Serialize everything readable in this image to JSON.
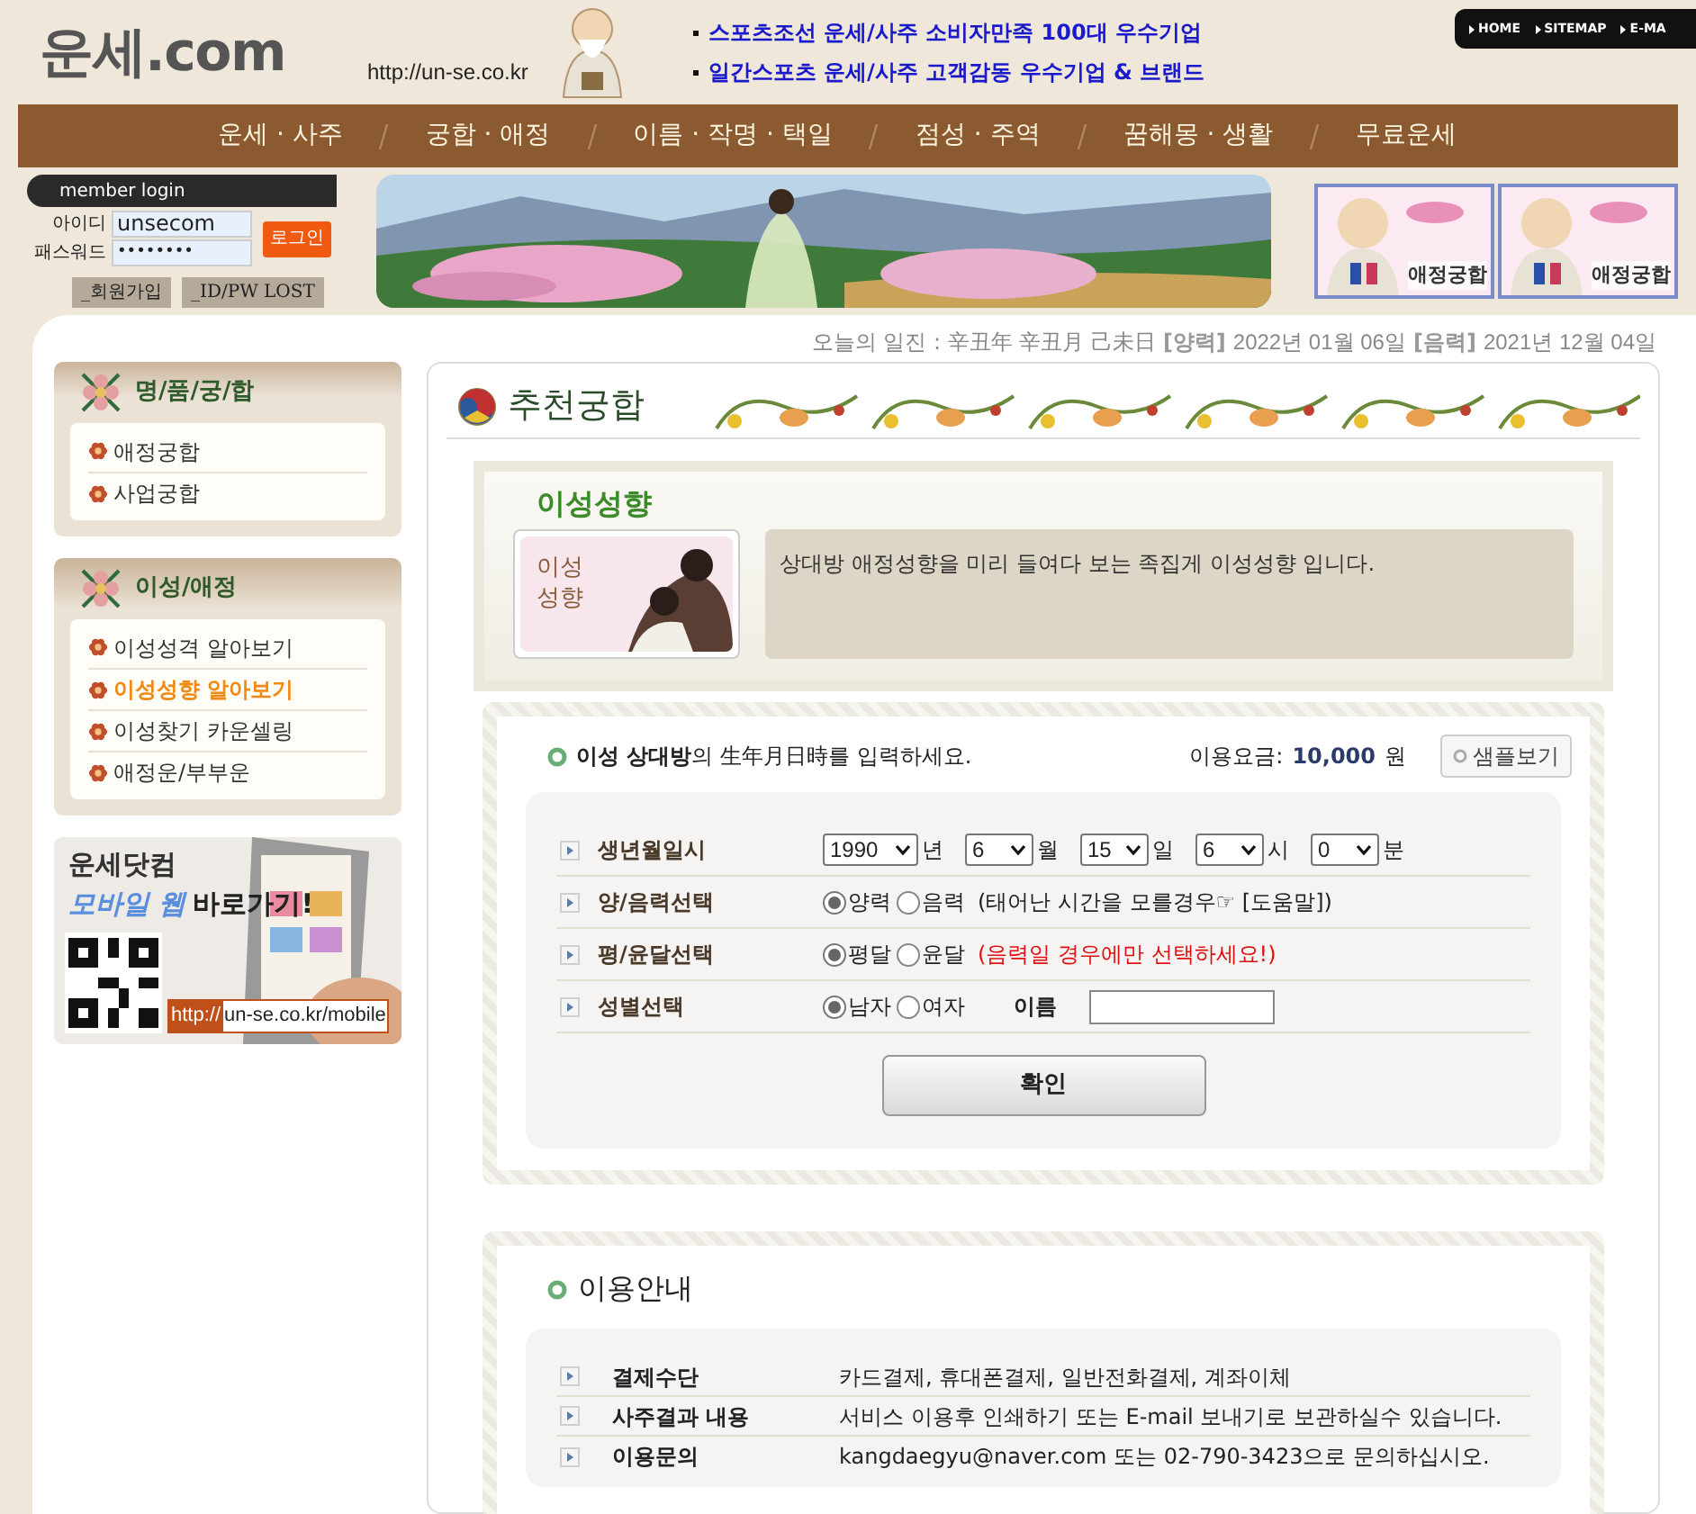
{
  "header": {
    "logo": "운세.com",
    "url": "http://un-se.co.kr",
    "headlines": [
      "스포츠조선 운세/사주 소비자만족 100대 우수기업",
      "일간스포츠 운세/사주 고객감동 우수기업 & 브랜드"
    ],
    "top_links": [
      "HOME",
      "SITEMAP",
      "E-MA"
    ]
  },
  "nav": [
    "운세 · 사주",
    "궁합 · 애정",
    "이름 · 작명 · 택일",
    "점성 · 주역",
    "꿈해몽 · 생활",
    "무료운세"
  ],
  "login": {
    "title": "member login",
    "id_label": "아이디",
    "id_value": "unsecom",
    "pw_label": "패스워드",
    "pw_value": "••••••••",
    "login_button": "로그인",
    "buttons": [
      "_회원가입",
      "_ID/PW LOST"
    ]
  },
  "banner_badges": [
    "애정궁합",
    "애정궁합"
  ],
  "date_line": {
    "label": "오늘의 일진 : 辛丑年 辛丑月 己未日",
    "solar_label": "[양력]",
    "solar": "2022년 01월 06일",
    "lunar_label": "[음력]",
    "lunar": "2021년 12월 04일"
  },
  "sidebar": [
    {
      "title": "명/품/궁/합",
      "items": [
        {
          "label": "애정궁합",
          "selected": false
        },
        {
          "label": "사업궁합",
          "selected": false
        }
      ]
    },
    {
      "title": "이성/애정",
      "items": [
        {
          "label": "이성성격 알아보기",
          "selected": false
        },
        {
          "label": "이성성향 알아보기",
          "selected": true
        },
        {
          "label": "이성찾기 카운셀링",
          "selected": false
        },
        {
          "label": "애정운/부부운",
          "selected": false
        }
      ]
    }
  ],
  "mobile_banner": {
    "brand": "운세닷컴",
    "line_1": "모바일 웹",
    "line_2": "바로가기!",
    "url_prefix": "http://",
    "url": "un-se.co.kr/mobile"
  },
  "main": {
    "title": "추천궁합",
    "section_title": "이성성향",
    "thumb_lines": [
      "이성",
      "성향"
    ],
    "description": "상대방 애정성향을 미리 들여다 보는 족집게 이성성향 입니다."
  },
  "form": {
    "intro": "**이성 상대방**의 生年月日時를 입력하세요.",
    "fee_label": "이용요금:",
    "fee": "10,000",
    "fee_unit": "원",
    "sample_button": "샘플보기",
    "rows": [
      {
        "kind": "date",
        "label": "생년월일시",
        "selects": [
          {
            "value": "1990",
            "unit": "년"
          },
          {
            "value": "6",
            "unit": "월"
          },
          {
            "value": "15",
            "unit": "일"
          },
          {
            "value": "6",
            "unit": "시"
          },
          {
            "value": "0",
            "unit": "분"
          }
        ]
      },
      {
        "kind": "radio",
        "label": "양/음력선택",
        "options": [
          {
            "label": "양력",
            "selected": true
          },
          {
            "label": "음력",
            "selected": false
          }
        ],
        "note": "(태어난 시간을 모를경우☞ [도움말])",
        "alert": false
      },
      {
        "kind": "radio",
        "label": "평/윤달선택",
        "options": [
          {
            "label": "평달",
            "selected": true
          },
          {
            "label": "윤달",
            "selected": false
          }
        ],
        "note": "(음력일 경우에만 선택하세요!)",
        "alert": true
      },
      {
        "kind": "gender",
        "label": "성별선택",
        "options": [
          {
            "label": "남자",
            "selected": true
          },
          {
            "label": "여자",
            "selected": false
          }
        ],
        "name_label": "이름"
      }
    ],
    "submit": "확인"
  },
  "info": {
    "title": "이용안내",
    "rows": [
      {
        "label": "결제수단",
        "value": "카드결제, 휴대폰결제, 일반전화결제, 계좌이체"
      },
      {
        "label": "사주결과 내용",
        "value": "서비스 이용후 인쇄하기 또는 E-mail 보내기로 보관하실수 있습니다."
      },
      {
        "label": "이용문의",
        "value": "kangdaegyu@naver.com 또는 02-790-3423으로 문의하십시오."
      }
    ]
  }
}
